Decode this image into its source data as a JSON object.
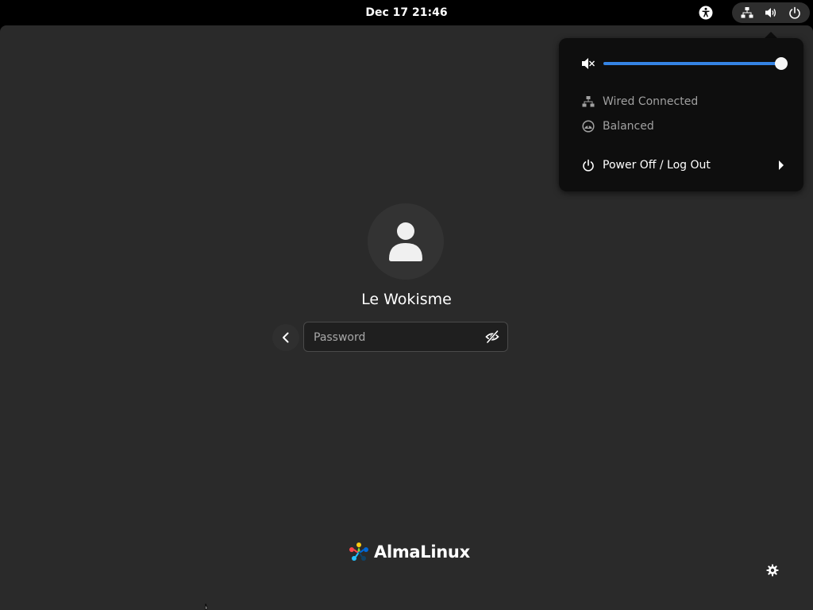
{
  "topbar": {
    "clock": "Dec 17  21:46",
    "icons": [
      "accessibility-icon",
      "network-wired-icon",
      "volume-icon",
      "power-icon"
    ]
  },
  "login": {
    "username": "Le Wokisme",
    "password_placeholder": "Password",
    "avatar_icon": "user-avatar-icon",
    "back_icon": "chevron-left-icon",
    "reveal_icon": "eye-slash-icon"
  },
  "branding": {
    "logo_text": "AlmaLinux"
  },
  "system_menu": {
    "volume": {
      "icon": "volume-muted-icon",
      "level": 1.0
    },
    "items": [
      {
        "label": "Wired Connected",
        "icon": "network-wired-icon",
        "enabled": false
      },
      {
        "label": "Balanced",
        "icon": "power-profile-icon",
        "enabled": false
      },
      {
        "label": "Power Off / Log Out",
        "icon": "power-icon",
        "enabled": true,
        "submenu": true
      }
    ]
  },
  "colors": {
    "accent": "#3584e4",
    "background": "#2a2a2a",
    "panel": "#000000",
    "menu_bg": "#0e0e0e"
  }
}
